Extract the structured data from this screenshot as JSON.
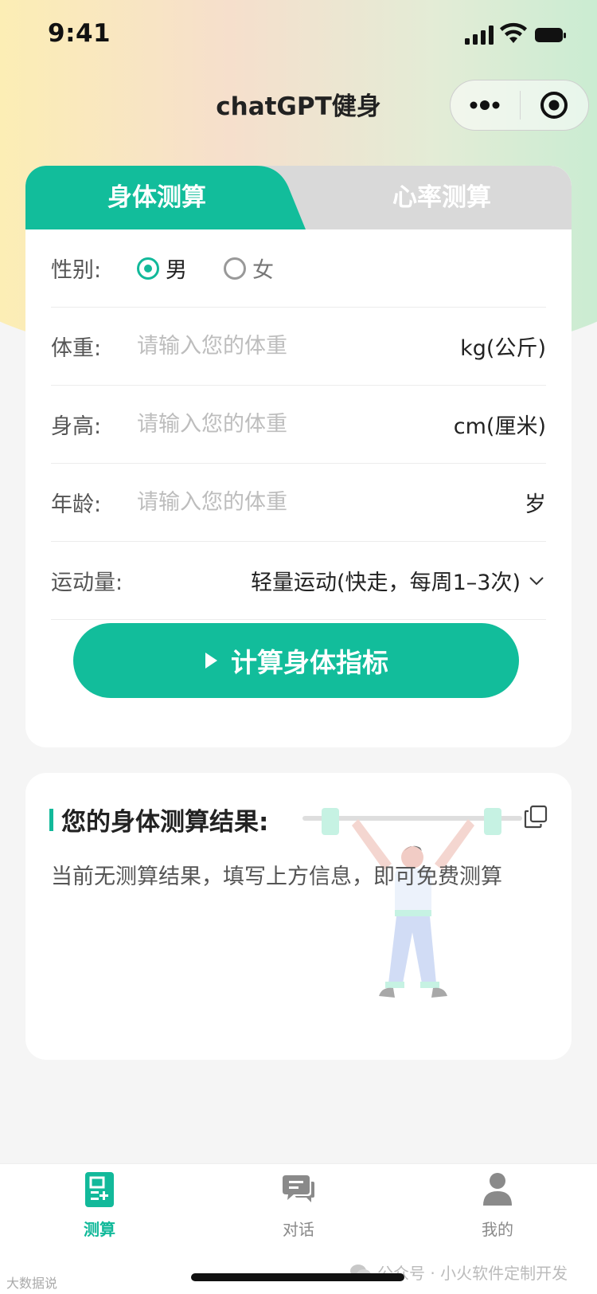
{
  "status_bar": {
    "time": "9:41"
  },
  "nav": {
    "title": "chatGPT健身"
  },
  "tabs": [
    {
      "label": "身体测算",
      "active": true
    },
    {
      "label": "心率测算",
      "active": false
    }
  ],
  "form": {
    "gender": {
      "label": "性别:",
      "options": [
        {
          "label": "男",
          "checked": true
        },
        {
          "label": "女",
          "checked": false
        }
      ]
    },
    "weight": {
      "label": "体重:",
      "placeholder": "请输入您的体重",
      "unit": "kg(公斤)"
    },
    "height": {
      "label": "身高:",
      "placeholder": "请输入您的体重",
      "unit": "cm(厘米)"
    },
    "age": {
      "label": "年龄:",
      "placeholder": "请输入您的体重",
      "unit": "岁"
    },
    "activity": {
      "label": "运动量:",
      "value": "轻量运动(快走，每周1–3次)"
    },
    "submit_label": "计算身体指标"
  },
  "result": {
    "title": "您的身体测算结果:",
    "empty_text": "当前无测算结果，填写上方信息，即可免费测算"
  },
  "tab_bar": [
    {
      "label": "测算",
      "icon": "calculator-icon",
      "active": true
    },
    {
      "label": "对话",
      "icon": "chat-icon",
      "active": false
    },
    {
      "label": "我的",
      "icon": "user-icon",
      "active": false
    }
  ],
  "watermarks": {
    "left": "大数据说",
    "right": "公众号 · 小火软件定制开发"
  },
  "colors": {
    "accent": "#12B99A",
    "tab_inactive": "#D9D9D9",
    "background": "#F5F5F5"
  }
}
